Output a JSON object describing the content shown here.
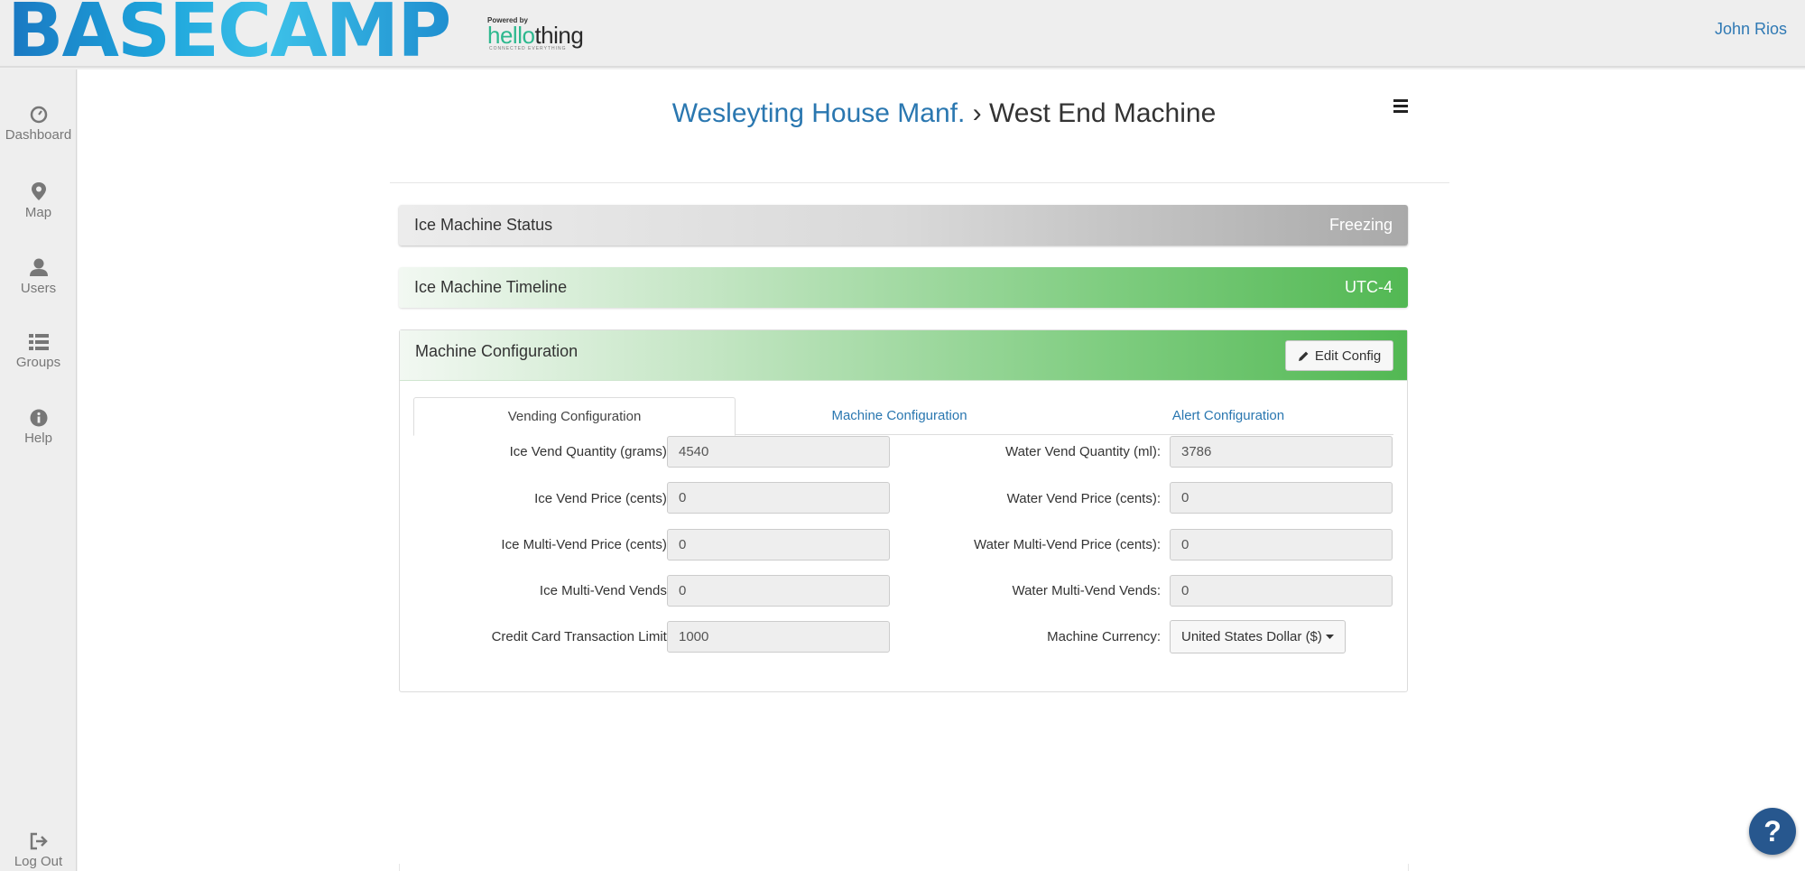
{
  "header": {
    "logo_text": "BASECAMP",
    "powered_by": "Powered by",
    "powered_logo_h": "hello",
    "powered_logo_rest": "thing",
    "powered_tagline": "CONNECTED EVERYTHING",
    "user_name": "John Rios"
  },
  "sidebar": {
    "items": [
      {
        "label": "Dashboard",
        "icon": "dashboard-icon"
      },
      {
        "label": "Map",
        "icon": "map-marker-icon"
      },
      {
        "label": "Users",
        "icon": "user-icon"
      },
      {
        "label": "Groups",
        "icon": "list-icon"
      },
      {
        "label": "Help",
        "icon": "info-icon"
      }
    ],
    "logout": {
      "label": "Log Out",
      "icon": "logout-icon"
    }
  },
  "breadcrumb": {
    "parent": "Wesleyting House Manf.",
    "separator": "›",
    "current": "West End Machine"
  },
  "status_panel": {
    "title": "Ice Machine Status",
    "value": "Freezing"
  },
  "timeline_panel": {
    "title": "Ice Machine Timeline",
    "value": "UTC-4"
  },
  "config_panel": {
    "title": "Machine Configuration",
    "edit_label": "Edit Config",
    "tabs": [
      "Vending Configuration",
      "Machine Configuration",
      "Alert Configuration"
    ],
    "active_tab": 0,
    "left_fields": [
      {
        "label": "Ice Vend Quantity (grams):",
        "value": "4540"
      },
      {
        "label": "Ice Vend Price (cents):",
        "value": "0"
      },
      {
        "label": "Ice Multi-Vend Price (cents):",
        "value": "0"
      },
      {
        "label": "Ice Multi-Vend Vends:",
        "value": "0"
      },
      {
        "label": "Credit Card Transaction Limit:",
        "value": "1000"
      }
    ],
    "right_fields": [
      {
        "label": "Water Vend Quantity (ml):",
        "value": "3786"
      },
      {
        "label": "Water Vend Price (cents):",
        "value": "0"
      },
      {
        "label": "Water Multi-Vend Price (cents):",
        "value": "0"
      },
      {
        "label": "Water Multi-Vend Vends:",
        "value": "0"
      }
    ],
    "currency": {
      "label": "Machine Currency:",
      "value": "United States Dollar ($)"
    }
  },
  "help_bubble": "?",
  "colors": {
    "accent_blue": "#2a77b0",
    "green_header": "#52b853",
    "help_bubble": "#27578e"
  }
}
